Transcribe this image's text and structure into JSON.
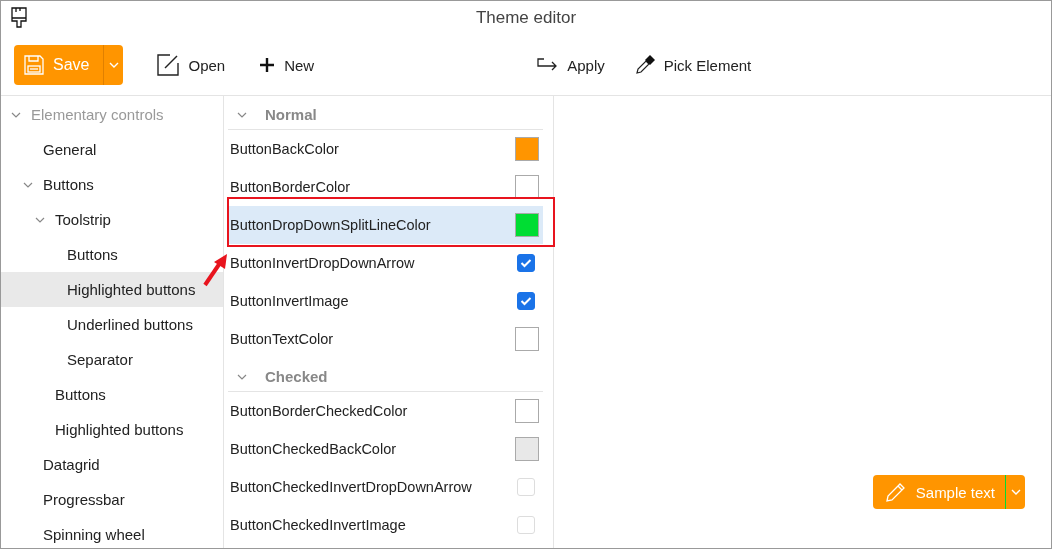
{
  "window": {
    "title": "Theme editor"
  },
  "toolbar": {
    "left": [
      {
        "kind": "save",
        "label": "Save"
      },
      {
        "kind": "open",
        "label": "Open"
      },
      {
        "kind": "new",
        "label": "New"
      }
    ],
    "right": [
      {
        "kind": "apply",
        "label": "Apply"
      },
      {
        "kind": "pick",
        "label": "Pick Element"
      }
    ]
  },
  "tree": [
    {
      "label": "Elementary controls",
      "expanded": true,
      "selected": false,
      "children": [
        {
          "label": "General",
          "selected": false
        },
        {
          "label": "Buttons",
          "expanded": true,
          "selected": false,
          "children": [
            {
              "label": "Toolstrip",
              "expanded": true,
              "selected": false,
              "children": [
                {
                  "label": "Buttons",
                  "selected": false
                },
                {
                  "label": "Highlighted buttons",
                  "selected": true
                },
                {
                  "label": "Underlined buttons",
                  "selected": false
                },
                {
                  "label": "Separator",
                  "selected": false
                }
              ]
            },
            {
              "label": "Buttons",
              "selected": false
            },
            {
              "label": "Highlighted buttons",
              "selected": false
            }
          ]
        },
        {
          "label": "Datagrid",
          "selected": false
        },
        {
          "label": "Progressbar",
          "selected": false
        },
        {
          "label": "Spinning wheel",
          "selected": false
        }
      ]
    }
  ],
  "groups": [
    {
      "title": "Normal",
      "expanded": true,
      "properties": [
        {
          "name": "ButtonBackColor",
          "kind": "color",
          "color": "#ff9500",
          "selected": false
        },
        {
          "name": "ButtonBorderColor",
          "kind": "color",
          "color": "#ffffff",
          "selected": false
        },
        {
          "name": "ButtonDropDownSplitLineColor",
          "kind": "color",
          "color": "#00dd33",
          "selected": true
        },
        {
          "name": "ButtonInvertDropDownArrow",
          "kind": "checkbox",
          "checked": true,
          "selected": false
        },
        {
          "name": "ButtonInvertImage",
          "kind": "checkbox",
          "checked": true,
          "selected": false
        },
        {
          "name": "ButtonTextColor",
          "kind": "color",
          "color": "#ffffff",
          "selected": false
        }
      ]
    },
    {
      "title": "Checked",
      "expanded": true,
      "properties": [
        {
          "name": "ButtonBorderCheckedColor",
          "kind": "color",
          "color": "#ffffff",
          "selected": false
        },
        {
          "name": "ButtonCheckedBackColor",
          "kind": "color",
          "color": "#e8e8e8",
          "selected": false
        },
        {
          "name": "ButtonCheckedInvertDropDownArrow",
          "kind": "checkbox",
          "checked": false,
          "selected": false
        },
        {
          "name": "ButtonCheckedInvertImage",
          "kind": "checkbox",
          "checked": false,
          "selected": false
        }
      ]
    }
  ],
  "preview": {
    "label": "Sample text"
  }
}
